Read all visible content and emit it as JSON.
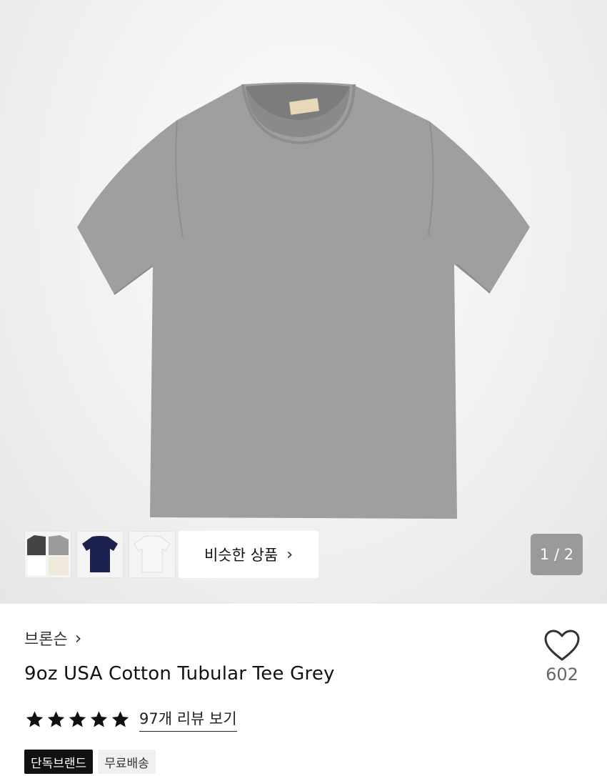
{
  "gallery": {
    "thumbnails": [
      {
        "label": "multi-color-thumbnail"
      },
      {
        "label": "navy-thumbnail"
      },
      {
        "label": "white-thumbnail"
      }
    ],
    "similar_label": "비슷한 상품",
    "page_indicator": "1 / 2"
  },
  "product": {
    "brand": "브론슨",
    "name": "9oz USA Cotton Tubular Tee Grey",
    "like_count": "602",
    "rating": {
      "stars": 5,
      "max": 5,
      "review_link": "97개 리뷰 보기"
    },
    "tags": [
      "단독브랜드",
      "무료배송"
    ]
  },
  "colors": {
    "tee": "#9b9b9b",
    "accent_dark": "#111111",
    "pager_bg": "#9a9a9a"
  }
}
